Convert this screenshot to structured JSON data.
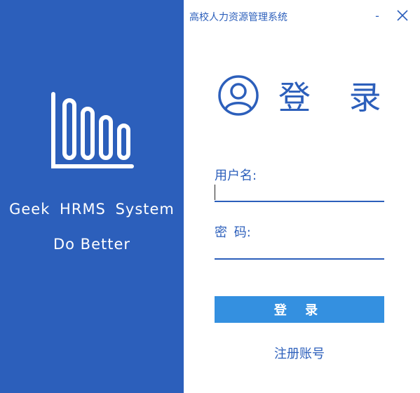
{
  "window": {
    "title": "高校人力资源管理系统",
    "minimize_label": "-",
    "close_icon": "close-icon"
  },
  "brand": {
    "logo_icon": "bar-chart-icon",
    "name": "Geek  HRMS  System",
    "slogan": "Do Better"
  },
  "login": {
    "hero_icon": "user-circle-icon",
    "heading": "登 录",
    "username_label": "用户名:",
    "username_value": "",
    "password_label": "密 码:",
    "password_value": "",
    "submit_label": "登 录",
    "register_link": "注册账号"
  },
  "colors": {
    "primary": "#2c5fbb",
    "button": "#3490e0",
    "background": "#ffffff"
  }
}
